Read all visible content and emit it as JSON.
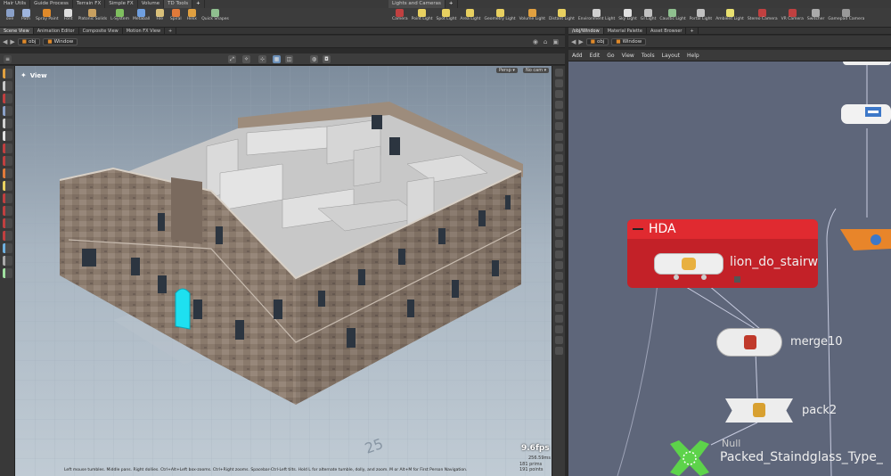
{
  "shelf_tabs_left": [
    "Hair Utils",
    "Guide Process",
    "Terrain FX",
    "Simple FX",
    "Volume",
    "TD Tools",
    "+"
  ],
  "shelf_tabs_right": [
    "Lights and Cameras",
    "+"
  ],
  "tools_left": [
    {
      "label": "ove",
      "color": "#8aa0c8"
    },
    {
      "label": "Path",
      "color": "#9fb5dd"
    },
    {
      "label": "Spray Paint",
      "color": "#e08a2a"
    },
    {
      "label": "Font",
      "color": "#dddddd"
    },
    {
      "label": "Platonic Solids",
      "color": "#c8a060"
    },
    {
      "label": "L-System",
      "color": "#7fbf5f"
    },
    {
      "label": "Metaball",
      "color": "#6f9fdf"
    },
    {
      "label": "File",
      "color": "#d9c07a"
    },
    {
      "label": "Spiral",
      "color": "#e07a3a"
    },
    {
      "label": "Helix",
      "color": "#e0a040"
    },
    {
      "label": "Quick Shapes",
      "color": "#8fbf8f"
    }
  ],
  "tools_right": [
    {
      "label": "Camera",
      "color": "#c04040"
    },
    {
      "label": "Point Light",
      "color": "#e8d060"
    },
    {
      "label": "Spot Light",
      "color": "#e8d060"
    },
    {
      "label": "Area Light",
      "color": "#e8d060"
    },
    {
      "label": "Geometry Light",
      "color": "#e8d060"
    },
    {
      "label": "Volume Light",
      "color": "#e0a040"
    },
    {
      "label": "Distant Light",
      "color": "#e8d060"
    },
    {
      "label": "Environment Light",
      "color": "#d0d0d0"
    },
    {
      "label": "Sky Light",
      "color": "#e0e0e0"
    },
    {
      "label": "GI Light",
      "color": "#c0c0c0"
    },
    {
      "label": "Caustic Light",
      "color": "#8fbf8f"
    },
    {
      "label": "Portal Light",
      "color": "#c0c0c0"
    },
    {
      "label": "Ambient Light",
      "color": "#e8e070"
    },
    {
      "label": "Stereo Camera",
      "color": "#c04040"
    },
    {
      "label": "VR Camera",
      "color": "#c04040"
    },
    {
      "label": "Switcher",
      "color": "#aaaaaa"
    },
    {
      "label": "Gamepad Camera",
      "color": "#999999"
    }
  ],
  "pane_tabs_left": [
    "Scene View",
    "Animation Editor",
    "Composite View",
    "Motion FX View",
    "+"
  ],
  "pane_tabs_right": [
    "/obj/Window",
    "Material Palette",
    "Asset Browser",
    "+"
  ],
  "path_left": {
    "root": "obj",
    "node": "Window"
  },
  "path_right": {
    "root": "obj",
    "node": "Window"
  },
  "viewport": {
    "title": "View",
    "persp": "Persp ▾",
    "cam": "No cam ▾",
    "fps": "9.6fps",
    "time": "256.59ms",
    "stats": [
      "181 prims",
      "191 points"
    ],
    "grid_label": "25",
    "status": "Left mouse tumbles. Middle pans. Right dollies. Ctrl+Alt+Left box-zooms. Ctrl+Right zooms. Spacebar-Ctrl-Left tilts. Hold L for alternate tumble, dolly, and zoom. M or Alt+M for First Person Navigation."
  },
  "network_menu": [
    "Add",
    "Edit",
    "Go",
    "View",
    "Tools",
    "Layout",
    "Help"
  ],
  "network": {
    "hda_label": "HDA",
    "node1": "lion_do_stairwindow",
    "node2": "merge10",
    "node3": "pack2",
    "node4_type": "Null",
    "node4": "Packed_Staindglass_Type_"
  },
  "colors": {
    "hda_red": "#d9282f",
    "network_bg": "#5e667a",
    "accent_orange": "#e08a2a"
  }
}
